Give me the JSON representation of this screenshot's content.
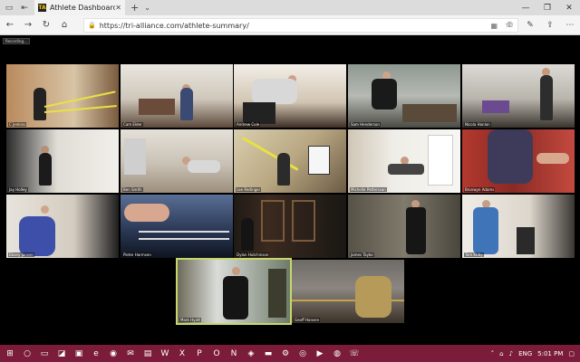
{
  "browser": {
    "tab_title": "Athlete Dashboard",
    "favicon_text": "TA",
    "url": "https://tri-alliance.com/athlete-summary/"
  },
  "meeting": {
    "recording_label": "Recording...",
    "tiles": [
      {
        "name": "C Jenkins"
      },
      {
        "name": "Cam Elder"
      },
      {
        "name": "Andrew Cole"
      },
      {
        "name": "Sam Henderson"
      },
      {
        "name": "Nicola Hanlon"
      },
      {
        "name": "Jay Holley"
      },
      {
        "name": "Ben Smith"
      },
      {
        "name": "Lee Redinger"
      },
      {
        "name": "Michelle Pettersson"
      },
      {
        "name": "Bronwyn Adams"
      },
      {
        "name": "Ebony Jansen"
      },
      {
        "name": "Pieter Harmsen"
      },
      {
        "name": "Dylan Hutchinson"
      },
      {
        "name": "James Taylor"
      },
      {
        "name": "Tom Kirby"
      },
      {
        "name": "Mark Hyatt"
      },
      {
        "name": "Geoff Hansen"
      }
    ]
  },
  "taskbar": {
    "language": "ENG",
    "time": "5:01 PM"
  },
  "icons": [
    "back-icon",
    "forward-icon",
    "refresh-icon",
    "home-icon",
    "search-icon",
    "star-icon",
    "settings-icon",
    "windows-icon"
  ]
}
